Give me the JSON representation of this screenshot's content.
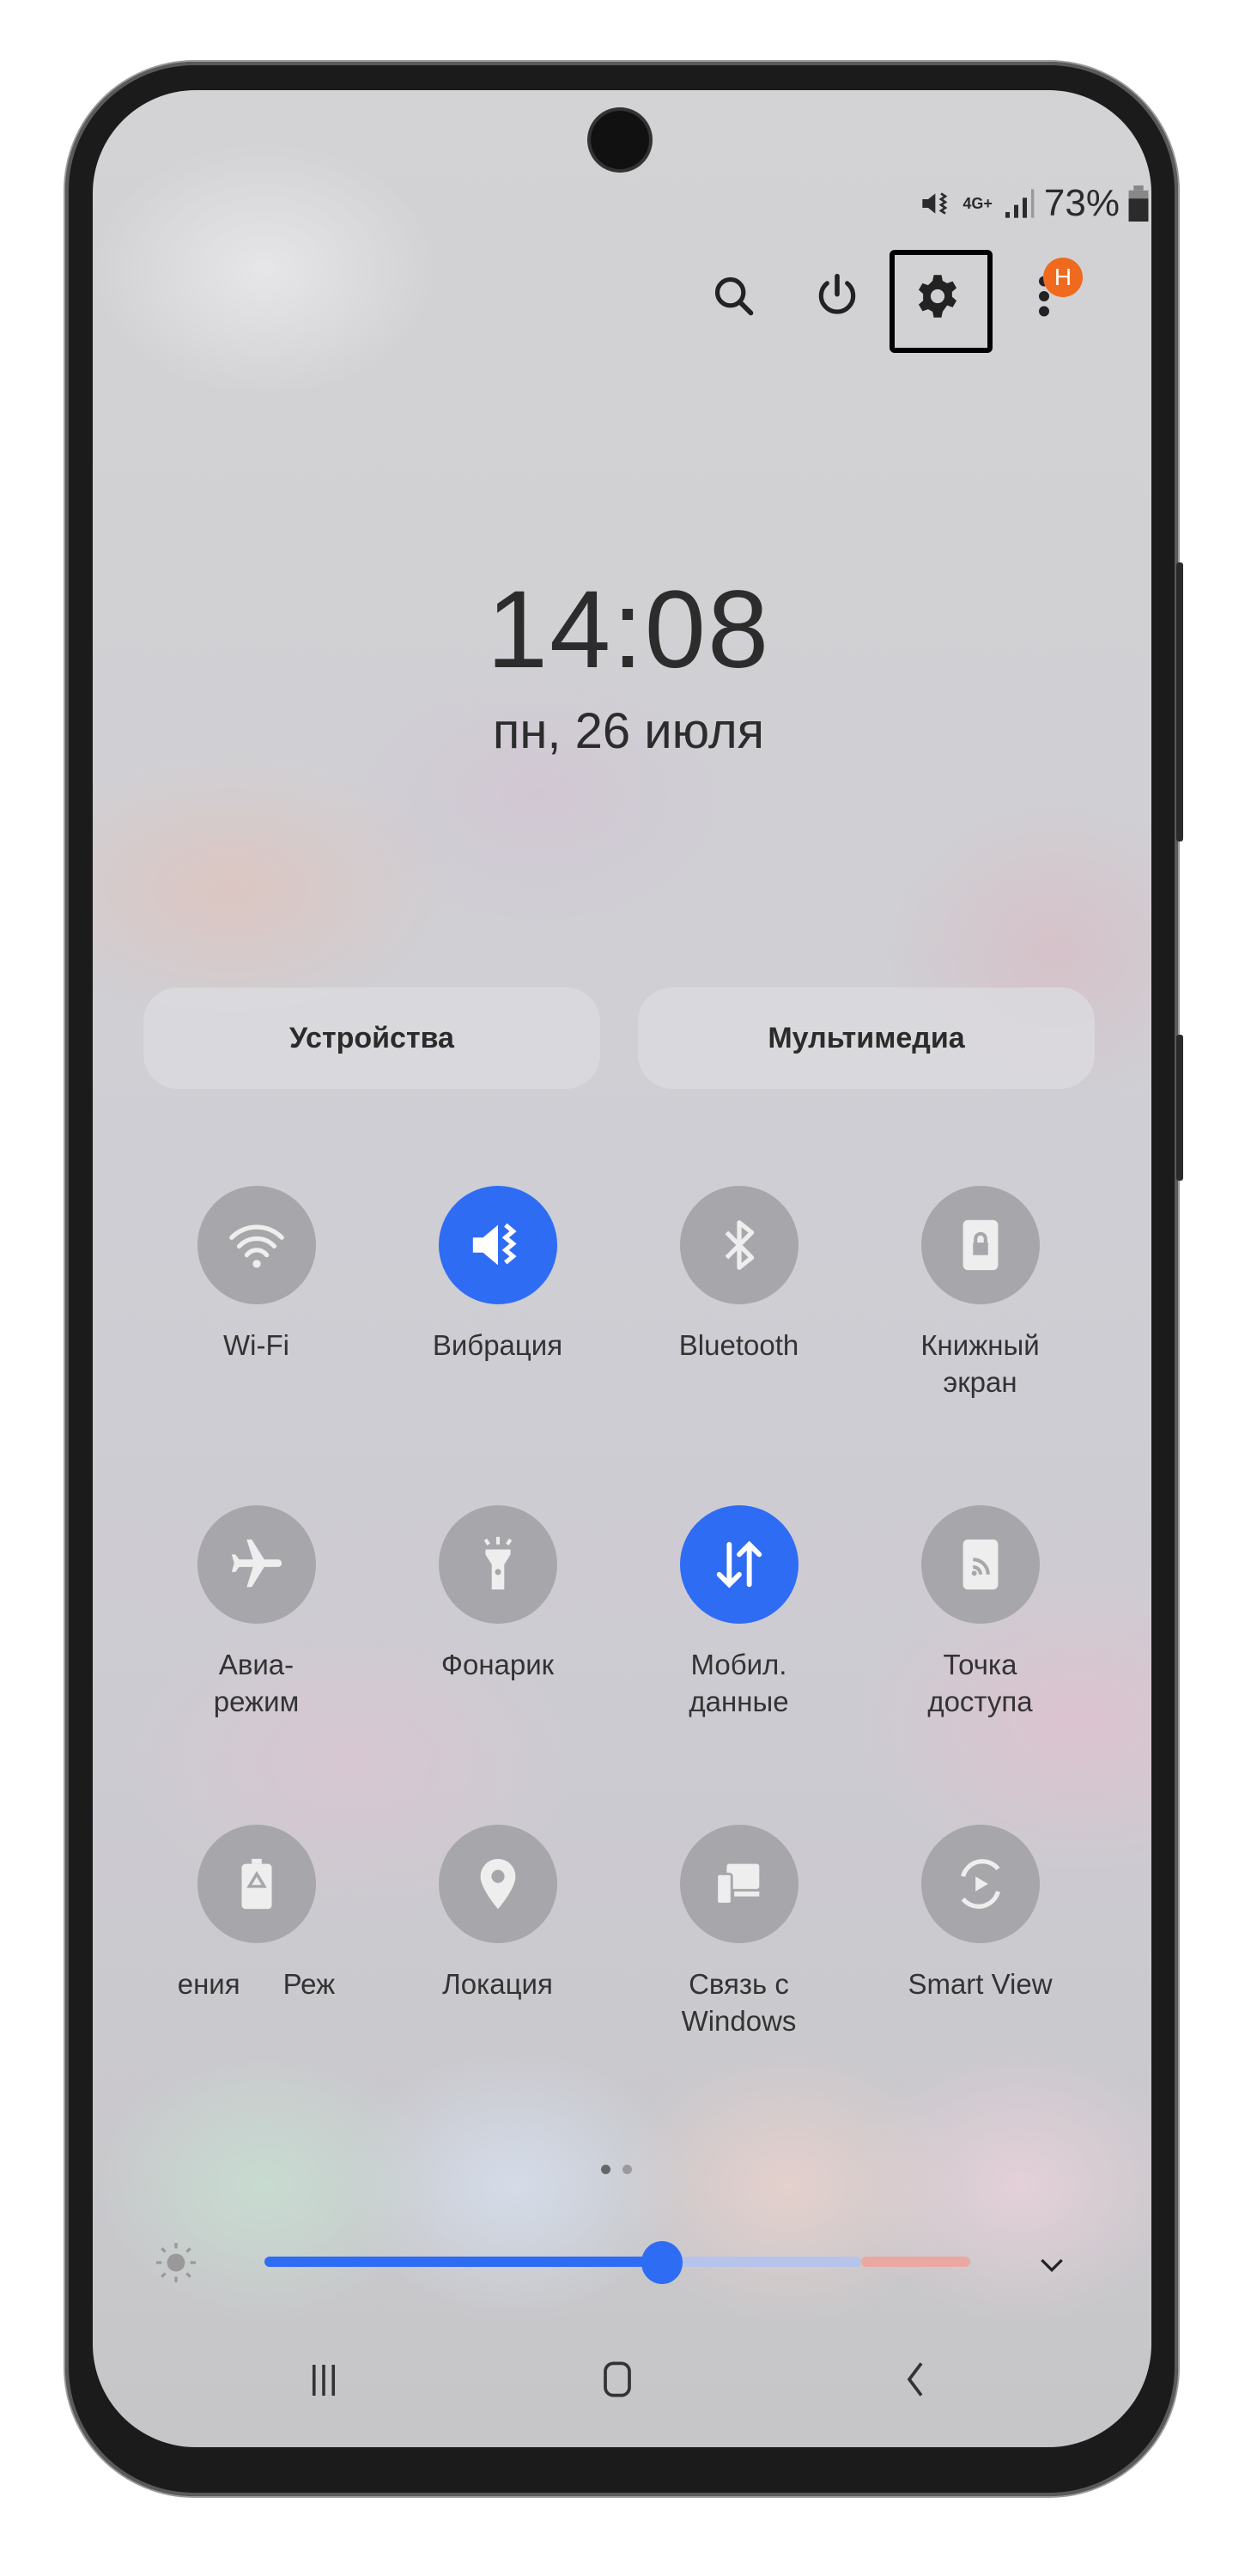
{
  "status_bar": {
    "battery_percent": "73%",
    "network": "4G+",
    "battery_level": 0.73
  },
  "top_actions": {
    "badge": "H",
    "highlighted": "settings"
  },
  "clock": {
    "time": "14:08",
    "date": "пн, 26 июля"
  },
  "panels": {
    "devices": "Устройства",
    "media": "Мультимедиа"
  },
  "tiles": [
    {
      "label": "Wi-Fi",
      "label2": "",
      "icon": "wifi-icon",
      "active": false
    },
    {
      "label": "Вибрация",
      "label2": "",
      "icon": "vibrate-icon",
      "active": true
    },
    {
      "label": "Bluetooth",
      "label2": "",
      "icon": "bluetooth-icon",
      "active": false
    },
    {
      "label": "Книжный",
      "label2": "экран",
      "icon": "portrait-lock-icon",
      "active": false
    },
    {
      "label": "Авиа-",
      "label2": "режим",
      "icon": "airplane-icon",
      "active": false
    },
    {
      "label": "Фонарик",
      "label2": "",
      "icon": "flashlight-icon",
      "active": false
    },
    {
      "label": "Мобил.",
      "label2": "данные",
      "icon": "mobile-data-icon",
      "active": true
    },
    {
      "label": "Точка",
      "label2": "доступа",
      "icon": "hotspot-icon",
      "active": false
    },
    {
      "label": "ения",
      "label2": "Реж",
      "icon": "power-saving-icon",
      "active": false
    },
    {
      "label": "Локация",
      "label2": "",
      "icon": "location-icon",
      "active": false
    },
    {
      "label": "Связь с",
      "label2": "Windows",
      "icon": "link-to-windows-icon",
      "active": false
    },
    {
      "label": "Smart View",
      "label2": "",
      "icon": "smart-view-icon",
      "active": false
    }
  ],
  "pages": {
    "current": 1,
    "total": 2
  },
  "brightness": {
    "level": 0.56
  },
  "colors": {
    "accent": "#2f6cf4",
    "tile_inactive": "#a7a6aa",
    "badge": "#ef6a1e"
  }
}
